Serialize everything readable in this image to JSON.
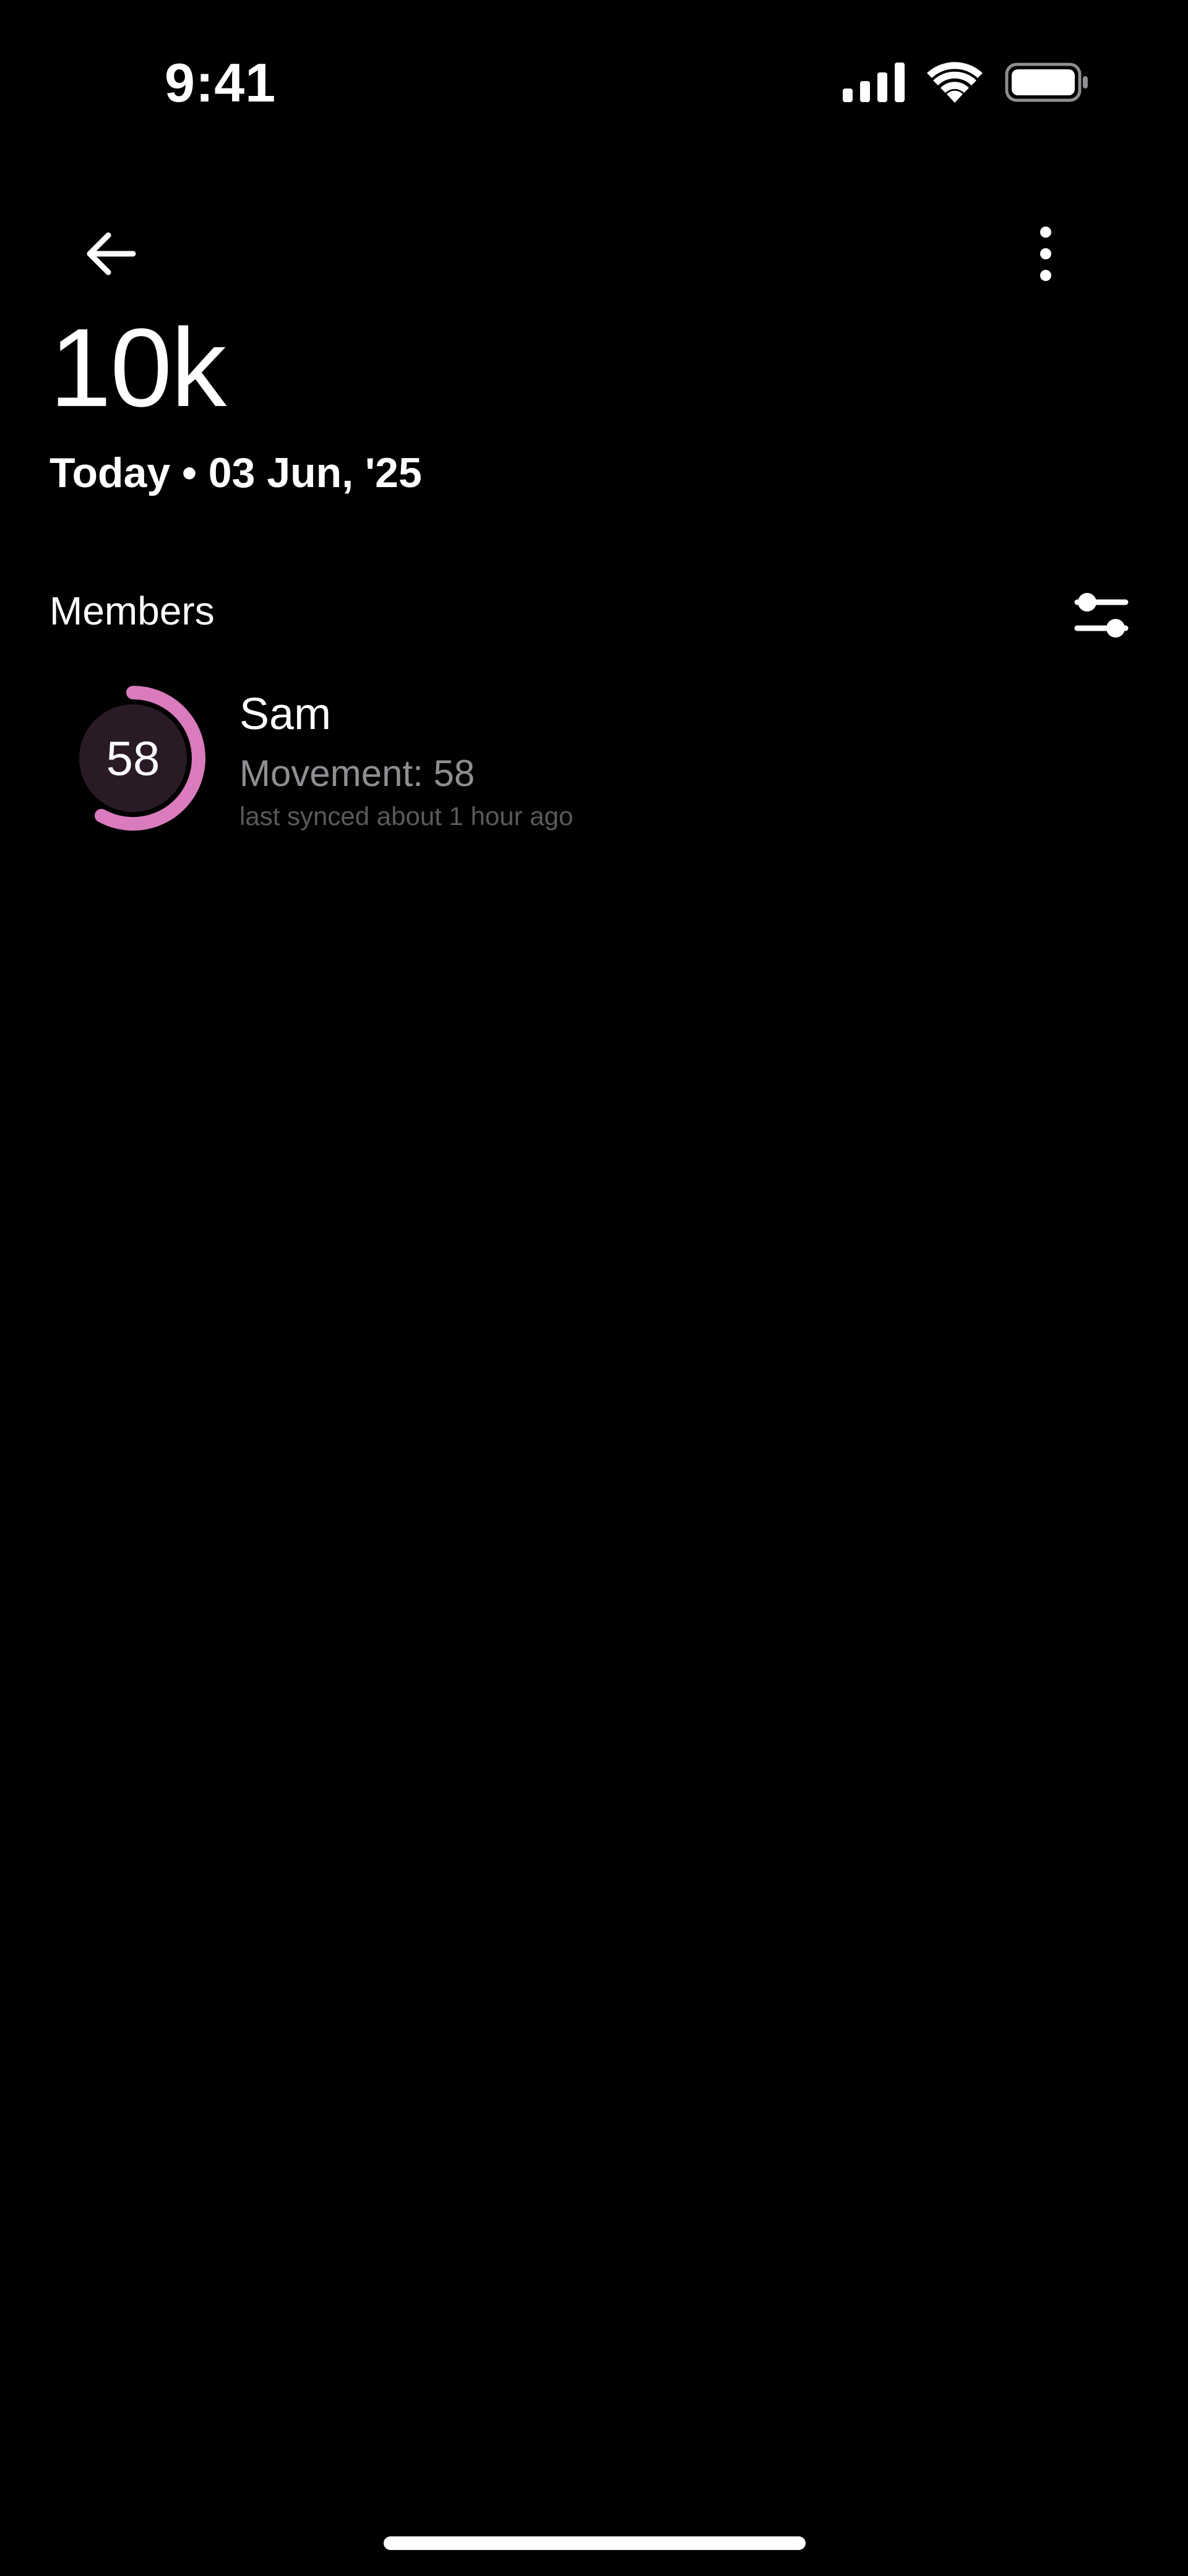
{
  "status_bar": {
    "time": "9:41",
    "icons": [
      "cellular-signal-icon",
      "wifi-icon",
      "battery-icon"
    ]
  },
  "header": {
    "back_icon": "arrow-left-icon",
    "more_icon": "more-vertical-icon",
    "title": "10k",
    "date_line": "Today • 03 Jun, '25"
  },
  "members": {
    "label": "Members",
    "filter_icon": "sliders-icon",
    "items": [
      {
        "name": "Sam",
        "score": "58",
        "score_progress": 0.58,
        "movement": "Movement: 58",
        "synced": "last synced about 1 hour ago"
      }
    ]
  },
  "colors": {
    "background": "#000000",
    "ring_accent": "#d97bbd",
    "ring_inner": "#2a1a26",
    "secondary_text": "#8e8e93",
    "tertiary_text": "#5a5a5e"
  }
}
